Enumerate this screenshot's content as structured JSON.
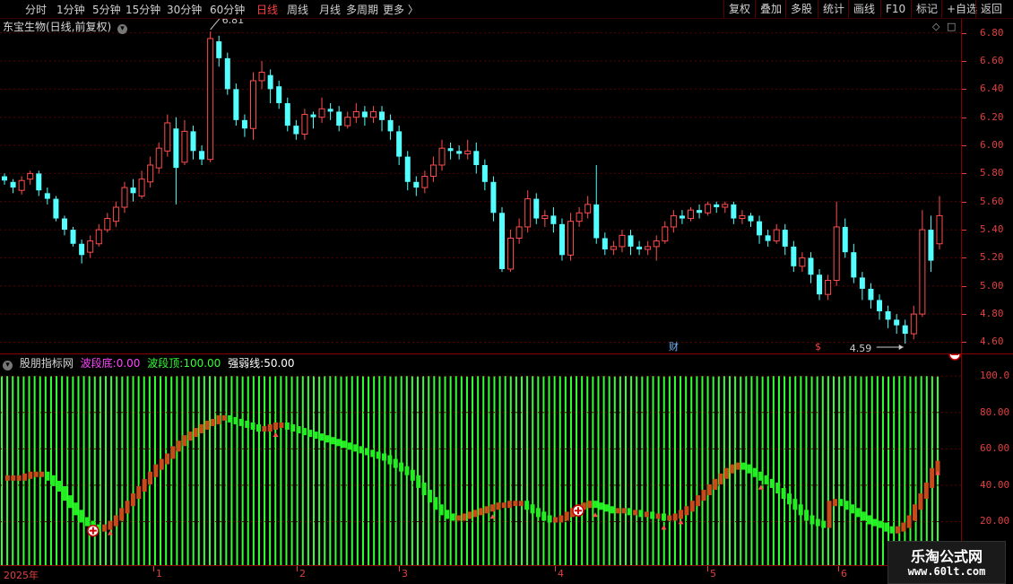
{
  "toolbar": {
    "periods": [
      {
        "label": "分时",
        "active": false
      },
      {
        "label": "1分钟",
        "active": false
      },
      {
        "label": "5分钟",
        "active": false
      },
      {
        "label": "15分钟",
        "active": false
      },
      {
        "label": "30分钟",
        "active": false
      },
      {
        "label": "60分钟",
        "active": false
      },
      {
        "label": "日线",
        "active": true
      },
      {
        "label": "周线",
        "active": false
      },
      {
        "label": "月线",
        "active": false
      },
      {
        "label": "多周期",
        "active": false
      },
      {
        "label": "更多 〉",
        "active": false
      }
    ],
    "actions": [
      "复权",
      "叠加",
      "多股",
      "统计",
      "画线",
      "F10",
      "标记",
      "+自选",
      "返回"
    ]
  },
  "stock": {
    "title": "东宝生物(日线,前复权)",
    "high_marker": "6.81",
    "low_marker": "4.59",
    "badge_cai": "财",
    "badge_dollar": "$"
  },
  "price_axis": {
    "labels": [
      "6.80",
      "6.60",
      "6.40",
      "6.20",
      "6.00",
      "5.80",
      "5.60",
      "5.40",
      "5.20",
      "5.00",
      "4.80",
      "4.60"
    ],
    "min": 4.52,
    "max": 6.9
  },
  "indicator": {
    "name": "股朋指标网",
    "label_bottom": "波段底:",
    "value_bottom": "0.00",
    "label_top": "波段顶:",
    "value_top": "100.00",
    "label_strength": "强弱线:",
    "value_strength": "50.00",
    "axis_labels": [
      "100.0",
      "80.00",
      "60.00",
      "40.00",
      "20.00"
    ],
    "color_bottom": "#ff44ff",
    "color_top": "#33ff33"
  },
  "time_axis": {
    "labels": [
      "2025年",
      "1",
      "2",
      "3",
      "4",
      "5",
      "6"
    ]
  },
  "watermark": {
    "title": "乐淘公式网",
    "url": "www.60lt.com"
  },
  "colors": {
    "up": "#ff4d4d",
    "down": "#54ffff",
    "axis": "#e04040",
    "grid": "#5a0000"
  },
  "chart_data": {
    "type": "candlestick",
    "title": "东宝生物(日线,前复权)",
    "ylim": [
      4.52,
      6.9
    ],
    "candles": [
      [
        5.78,
        5.75,
        5.8,
        5.72
      ],
      [
        5.74,
        5.7,
        5.76,
        5.66
      ],
      [
        5.68,
        5.75,
        5.78,
        5.65
      ],
      [
        5.76,
        5.8,
        5.82,
        5.72
      ],
      [
        5.8,
        5.68,
        5.82,
        5.64
      ],
      [
        5.66,
        5.62,
        5.7,
        5.58
      ],
      [
        5.62,
        5.48,
        5.64,
        5.46
      ],
      [
        5.48,
        5.4,
        5.5,
        5.36
      ],
      [
        5.4,
        5.3,
        5.42,
        5.28
      ],
      [
        5.3,
        5.22,
        5.33,
        5.16
      ],
      [
        5.24,
        5.32,
        5.36,
        5.2
      ],
      [
        5.3,
        5.4,
        5.44,
        5.28
      ],
      [
        5.4,
        5.48,
        5.52,
        5.38
      ],
      [
        5.46,
        5.56,
        5.6,
        5.42
      ],
      [
        5.56,
        5.7,
        5.74,
        5.52
      ],
      [
        5.7,
        5.66,
        5.76,
        5.6
      ],
      [
        5.64,
        5.76,
        5.82,
        5.62
      ],
      [
        5.74,
        5.86,
        5.92,
        5.7
      ],
      [
        5.84,
        5.98,
        6.02,
        5.8
      ],
      [
        5.96,
        6.16,
        6.22,
        5.92
      ],
      [
        6.12,
        5.84,
        6.2,
        5.58
      ],
      [
        5.88,
        6.1,
        6.18,
        5.86
      ],
      [
        6.1,
        5.96,
        6.14,
        5.9
      ],
      [
        5.96,
        5.9,
        6.0,
        5.86
      ],
      [
        5.9,
        6.76,
        6.81,
        5.88
      ],
      [
        6.74,
        6.62,
        6.78,
        6.56
      ],
      [
        6.62,
        6.4,
        6.66,
        6.36
      ],
      [
        6.4,
        6.18,
        6.44,
        6.14
      ],
      [
        6.18,
        6.12,
        6.22,
        6.06
      ],
      [
        6.12,
        6.46,
        6.52,
        6.04
      ],
      [
        6.46,
        6.52,
        6.6,
        6.4
      ],
      [
        6.5,
        6.4,
        6.54,
        6.3
      ],
      [
        6.42,
        6.3,
        6.46,
        6.26
      ],
      [
        6.3,
        6.14,
        6.34,
        6.1
      ],
      [
        6.14,
        6.08,
        6.18,
        6.04
      ],
      [
        6.08,
        6.22,
        6.26,
        6.04
      ],
      [
        6.22,
        6.2,
        6.24,
        6.12
      ],
      [
        6.2,
        6.26,
        6.34,
        6.16
      ],
      [
        6.26,
        6.24,
        6.3,
        6.18
      ],
      [
        6.24,
        6.14,
        6.28,
        6.1
      ],
      [
        6.14,
        6.2,
        6.24,
        6.12
      ],
      [
        6.2,
        6.24,
        6.3,
        6.16
      ],
      [
        6.24,
        6.2,
        6.28,
        6.14
      ],
      [
        6.2,
        6.24,
        6.28,
        6.16
      ],
      [
        6.24,
        6.18,
        6.28,
        6.1
      ],
      [
        6.18,
        6.1,
        6.22,
        6.04
      ],
      [
        6.1,
        5.92,
        6.14,
        5.86
      ],
      [
        5.92,
        5.74,
        5.96,
        5.68
      ],
      [
        5.74,
        5.7,
        5.78,
        5.64
      ],
      [
        5.7,
        5.78,
        5.82,
        5.66
      ],
      [
        5.78,
        5.86,
        5.92,
        5.74
      ],
      [
        5.86,
        5.98,
        6.04,
        5.82
      ],
      [
        5.98,
        5.96,
        6.02,
        5.9
      ],
      [
        5.96,
        5.94,
        6.0,
        5.9
      ],
      [
        5.94,
        5.96,
        6.04,
        5.9
      ],
      [
        5.96,
        5.86,
        6.02,
        5.8
      ],
      [
        5.86,
        5.74,
        5.9,
        5.68
      ],
      [
        5.74,
        5.52,
        5.78,
        5.46
      ],
      [
        5.52,
        5.12,
        5.56,
        5.1
      ],
      [
        5.12,
        5.34,
        5.4,
        5.1
      ],
      [
        5.34,
        5.42,
        5.48,
        5.3
      ],
      [
        5.42,
        5.62,
        5.68,
        5.38
      ],
      [
        5.62,
        5.48,
        5.66,
        5.44
      ],
      [
        5.48,
        5.5,
        5.54,
        5.42
      ],
      [
        5.5,
        5.44,
        5.56,
        5.38
      ],
      [
        5.44,
        5.22,
        5.48,
        5.18
      ],
      [
        5.22,
        5.46,
        5.52,
        5.18
      ],
      [
        5.46,
        5.52,
        5.56,
        5.42
      ],
      [
        5.52,
        5.58,
        5.64,
        5.48
      ],
      [
        5.58,
        5.34,
        5.86,
        5.3
      ],
      [
        5.34,
        5.26,
        5.38,
        5.22
      ],
      [
        5.26,
        5.28,
        5.32,
        5.22
      ],
      [
        5.28,
        5.36,
        5.4,
        5.24
      ],
      [
        5.36,
        5.28,
        5.4,
        5.22
      ],
      [
        5.28,
        5.26,
        5.32,
        5.22
      ],
      [
        5.26,
        5.28,
        5.32,
        5.22
      ],
      [
        5.28,
        5.32,
        5.36,
        5.18
      ],
      [
        5.32,
        5.42,
        5.46,
        5.3
      ],
      [
        5.42,
        5.5,
        5.54,
        5.38
      ],
      [
        5.5,
        5.48,
        5.54,
        5.44
      ],
      [
        5.48,
        5.54,
        5.56,
        5.46
      ],
      [
        5.54,
        5.52,
        5.58,
        5.48
      ],
      [
        5.52,
        5.58,
        5.6,
        5.5
      ],
      [
        5.58,
        5.56,
        5.6,
        5.52
      ],
      [
        5.56,
        5.58,
        5.6,
        5.52
      ],
      [
        5.58,
        5.48,
        5.6,
        5.44
      ],
      [
        5.48,
        5.5,
        5.54,
        5.44
      ],
      [
        5.5,
        5.46,
        5.52,
        5.42
      ],
      [
        5.46,
        5.36,
        5.5,
        5.3
      ],
      [
        5.36,
        5.32,
        5.4,
        5.28
      ],
      [
        5.32,
        5.4,
        5.44,
        5.3
      ],
      [
        5.4,
        5.28,
        5.44,
        5.22
      ],
      [
        5.28,
        5.14,
        5.32,
        5.1
      ],
      [
        5.14,
        5.2,
        5.24,
        5.1
      ],
      [
        5.2,
        5.08,
        5.24,
        5.02
      ],
      [
        5.08,
        4.94,
        5.12,
        4.9
      ],
      [
        4.94,
        5.04,
        5.08,
        4.9
      ],
      [
        5.04,
        5.42,
        5.6,
        5.0
      ],
      [
        5.42,
        5.24,
        5.48,
        5.2
      ],
      [
        5.24,
        5.06,
        5.3,
        5.02
      ],
      [
        5.06,
        4.98,
        5.1,
        4.9
      ],
      [
        4.98,
        4.9,
        5.02,
        4.84
      ],
      [
        4.9,
        4.82,
        4.94,
        4.76
      ],
      [
        4.82,
        4.76,
        4.86,
        4.7
      ],
      [
        4.76,
        4.72,
        4.8,
        4.66
      ],
      [
        4.72,
        4.66,
        4.76,
        4.59
      ],
      [
        4.66,
        4.8,
        4.86,
        4.62
      ],
      [
        4.8,
        5.4,
        5.54,
        4.78
      ],
      [
        5.4,
        5.18,
        5.5,
        5.1
      ],
      [
        5.3,
        5.5,
        5.64,
        5.26
      ]
    ],
    "indicator_values": [
      44,
      44,
      44,
      44,
      45,
      46,
      46,
      46,
      44,
      41,
      38,
      33,
      29,
      25,
      21,
      19,
      17,
      16,
      17,
      19,
      22,
      26,
      30,
      34,
      38,
      42,
      46,
      50,
      53,
      56,
      60,
      63,
      66,
      68,
      70,
      72,
      74,
      75,
      77,
      77,
      76,
      75,
      74,
      73,
      72,
      71,
      71,
      72,
      73,
      73,
      72,
      71,
      70,
      69,
      68,
      67,
      66,
      65,
      64,
      63,
      62,
      61,
      60,
      59,
      58,
      57,
      56,
      55,
      53,
      51,
      49,
      47,
      44,
      40,
      36,
      32,
      28,
      25,
      23,
      22,
      22,
      23,
      24,
      25,
      26,
      27,
      28,
      29,
      29,
      30,
      30,
      30,
      28,
      26,
      24,
      22,
      21,
      21,
      22,
      24,
      26,
      28,
      29,
      30,
      29,
      28,
      27,
      26,
      26,
      26,
      25,
      25,
      24,
      24,
      23,
      23,
      22,
      22,
      23,
      25,
      27,
      30,
      33,
      36,
      39,
      42,
      45,
      48,
      50,
      51,
      50,
      48,
      46,
      44,
      42,
      40,
      37,
      34,
      31,
      28,
      25,
      22,
      20,
      19,
      18,
      30,
      31,
      30,
      28,
      26,
      24,
      22,
      20,
      19,
      18,
      16,
      15,
      16,
      18,
      22,
      28,
      34,
      40,
      48,
      52
    ]
  }
}
